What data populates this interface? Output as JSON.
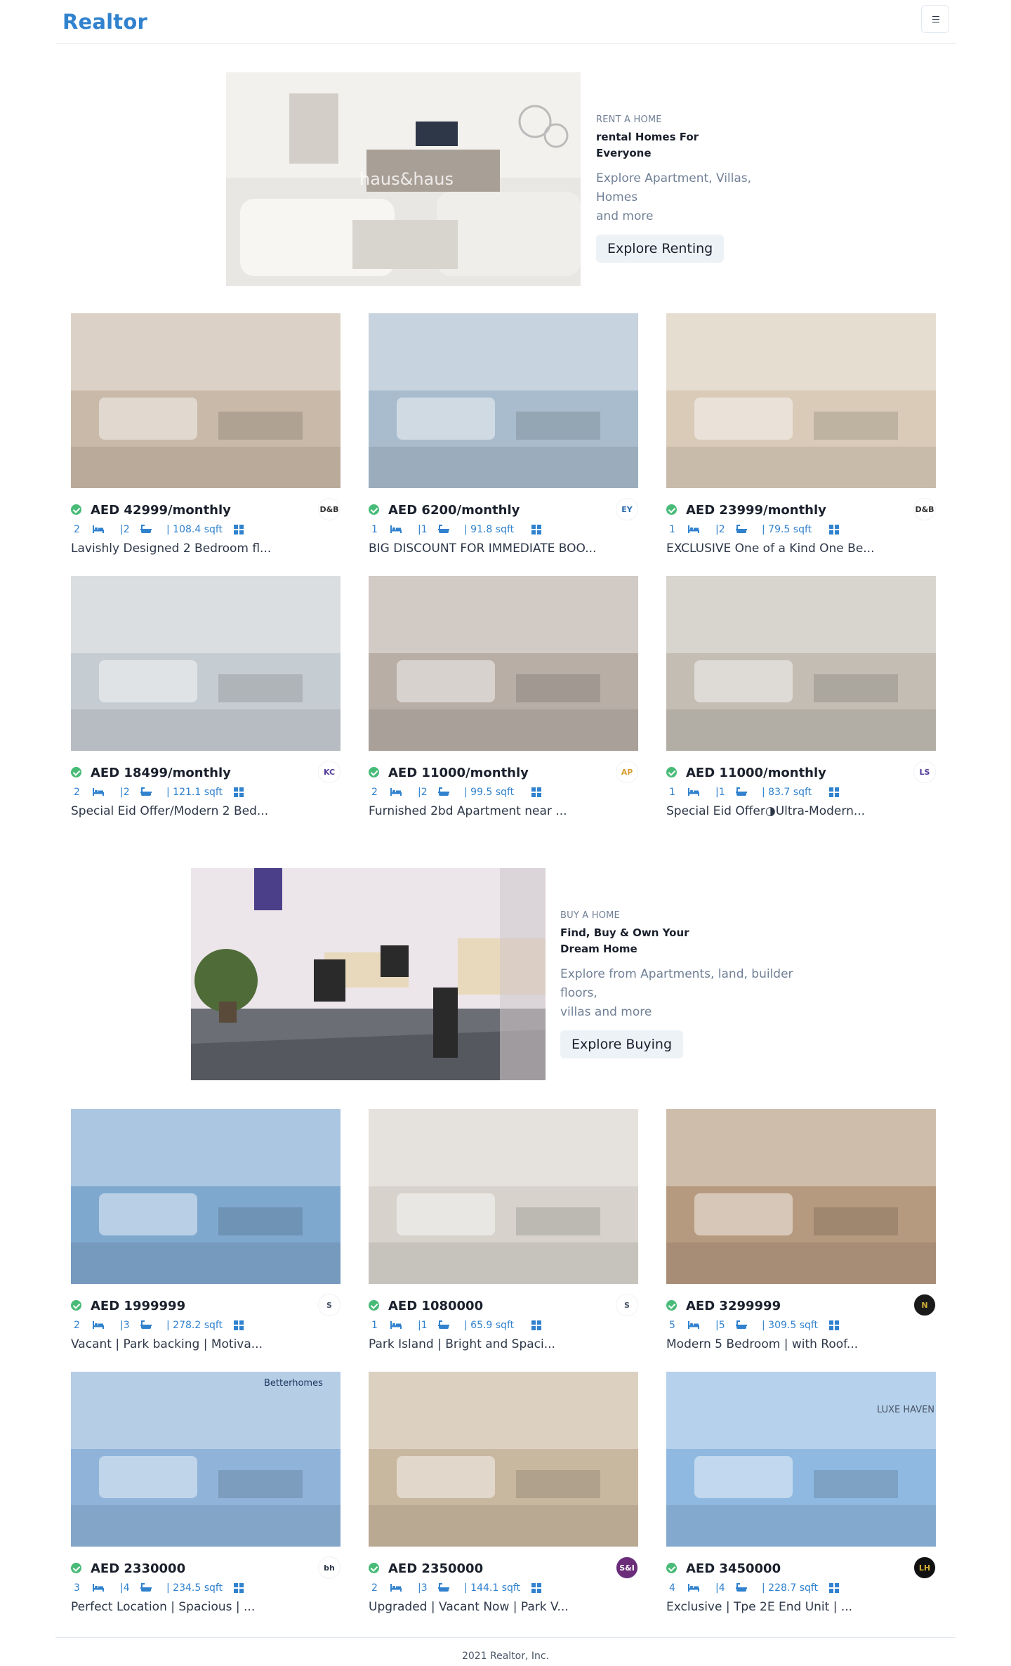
{
  "header": {
    "logo": "Realtor",
    "menu_icon": "hamburger-icon"
  },
  "rent_banner": {
    "kicker": "RENT A HOME",
    "title_line1": "rental Homes For",
    "title_line2": "Everyone",
    "desc_line1": "Explore Apartment, Villas, Homes",
    "desc_line2": "and more",
    "button": "Explore Renting",
    "image_watermark": "haus&haus"
  },
  "buy_banner": {
    "kicker": "BUY A HOME",
    "title_line1": "Find, Buy & Own Your",
    "title_line2": "Dream Home",
    "desc_line1": "Explore from Apartments, land, builder floors,",
    "desc_line2": "villas and more",
    "button": "Explore Buying"
  },
  "rent_listings": [
    {
      "price": "AED 42999/monthly",
      "rooms": "2",
      "baths": "|2",
      "area": "| 108.4 sqft",
      "title": "Lavishly Designed 2 Bedroom fl...",
      "agency": "D&B",
      "agency_color": "#ffffff",
      "agency_text": "#333333",
      "photo": "#c9b9a8"
    },
    {
      "price": "AED 6200/monthly",
      "rooms": "1",
      "baths": "|1",
      "area": "| 91.8 sqft",
      "title": "BIG DISCOUNT FOR IMMEDIATE BOO...",
      "agency": "EY",
      "agency_color": "#ffffff",
      "agency_text": "#2b6cb0",
      "photo": "#a9bccd"
    },
    {
      "price": "AED 23999/monthly",
      "rooms": "1",
      "baths": "|2",
      "area": "| 79.5 sqft",
      "title": "EXCLUSIVE One of a Kind One Be...",
      "agency": "D&B",
      "agency_color": "#ffffff",
      "agency_text": "#333333",
      "photo": "#d9cbb8"
    },
    {
      "price": "AED 18499/monthly",
      "rooms": "2",
      "baths": "|2",
      "area": "| 121.1 sqft",
      "title": "Special Eid Offer/Modern 2 Bed...",
      "agency": "KC",
      "agency_color": "#ffffff",
      "agency_text": "#553c9a",
      "photo": "#c6cdd2"
    },
    {
      "price": "AED 11000/monthly",
      "rooms": "2",
      "baths": "|2",
      "area": "| 99.5 sqft",
      "title": "Furnished 2bd Apartment near ...",
      "agency": "AP",
      "agency_color": "#ffffff",
      "agency_text": "#d69e2e",
      "photo": "#b8aea6"
    },
    {
      "price": "AED 11000/monthly",
      "rooms": "1",
      "baths": "|1",
      "area": "| 83.7 sqft",
      "title": "Special Eid Offer◑Ultra-Modern...",
      "agency": "LS",
      "agency_color": "#ffffff",
      "agency_text": "#553c9a",
      "photo": "#c3bdb4"
    }
  ],
  "buy_listings": [
    {
      "price": "AED 1999999",
      "rooms": "2",
      "baths": "|3",
      "area": "| 278.2 sqft",
      "title": "Vacant | Park backing | Motiva...",
      "agency": "S",
      "agency_color": "#ffffff",
      "agency_text": "#4a5568",
      "photo": "#7fa8cf"
    },
    {
      "price": "AED 1080000",
      "rooms": "1",
      "baths": "|1",
      "area": "| 65.9 sqft",
      "title": "Park Island | Bright and Spaci...",
      "agency": "S",
      "agency_color": "#ffffff",
      "agency_text": "#4a5568",
      "photo": "#d7d3cc"
    },
    {
      "price": "AED 3299999",
      "rooms": "5",
      "baths": "|5",
      "area": "| 309.5 sqft",
      "title": "Modern 5 Bedroom | with Roof...",
      "agency": "N",
      "agency_color": "#1a1a1a",
      "agency_text": "#d4af37",
      "photo": "#b69a7f"
    },
    {
      "price": "AED 2330000",
      "rooms": "3",
      "baths": "|4",
      "area": "| 234.5 sqft",
      "title": "Perfect Location | Spacious | ...",
      "agency": "bh",
      "agency_color": "#ffffff",
      "agency_text": "#2d3748",
      "photo": "#8fb3d9",
      "photo_label": "Betterhomes"
    },
    {
      "price": "AED 2350000",
      "rooms": "2",
      "baths": "|3",
      "area": "| 144.1 sqft",
      "title": "Upgraded | Vacant Now | Park V...",
      "agency": "S&I",
      "agency_color": "#6b2c7a",
      "agency_text": "#ffffff",
      "photo": "#c9b8a0"
    },
    {
      "price": "AED 3450000",
      "rooms": "4",
      "baths": "|4",
      "area": "| 228.7 sqft",
      "title": "Exclusive | Tpe 2E End Unit | ...",
      "agency": "LH",
      "agency_color": "#111111",
      "agency_text": "#d4af37",
      "photo": "#8fb9e0",
      "photo_label": "LUXE HAVEN"
    }
  ],
  "footer": {
    "text": "2021 Realtor, Inc."
  }
}
